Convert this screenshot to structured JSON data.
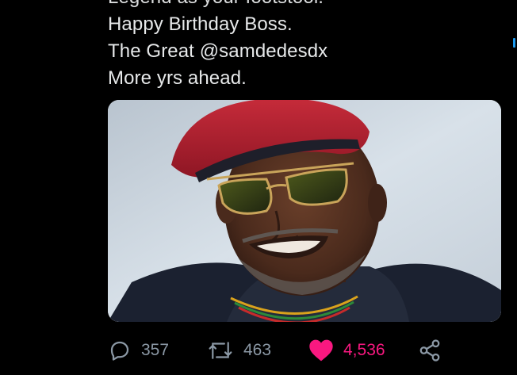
{
  "tweet": {
    "lines": [
      "Legend as your footstool.",
      "Happy Birthday Boss.",
      "The Great @samdedesdx",
      "More yrs ahead."
    ]
  },
  "actions": {
    "reply": {
      "icon": "reply-icon",
      "count": "357"
    },
    "retweet": {
      "icon": "retweet-icon",
      "count": "463"
    },
    "like": {
      "icon": "heart-icon",
      "count": "4,536",
      "active": true
    },
    "share": {
      "icon": "share-icon"
    }
  },
  "colors": {
    "background": "#000000",
    "text": "#e7e9ea",
    "muted": "#8b98a5",
    "like": "#f91880",
    "accent": "#1d9bf0"
  }
}
